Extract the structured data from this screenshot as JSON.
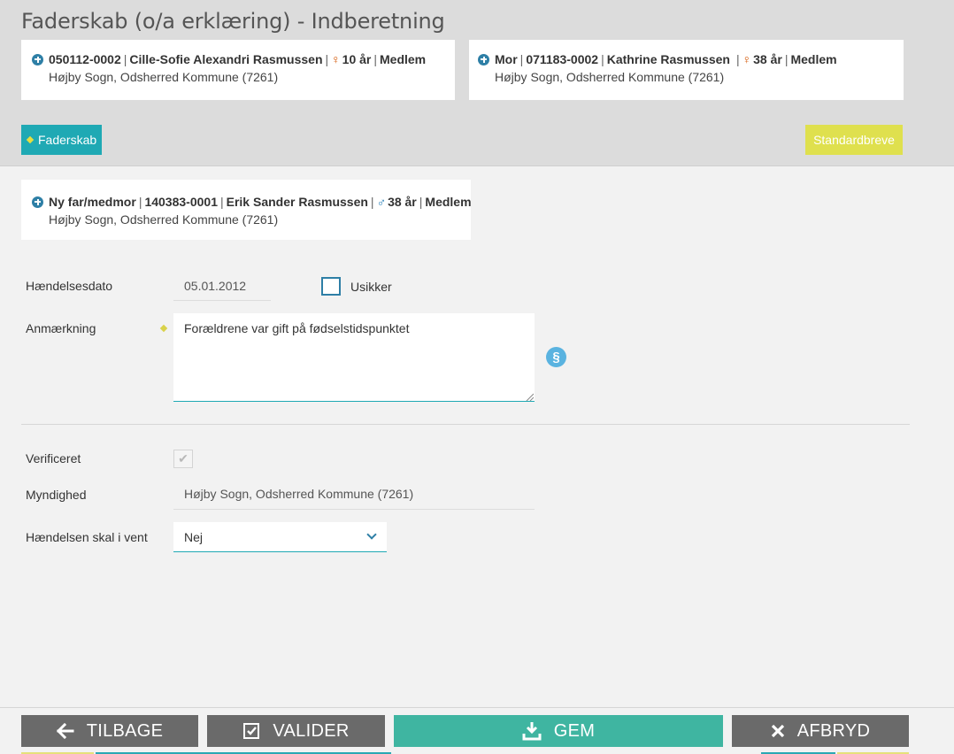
{
  "page": {
    "title": "Faderskab (o/a erklæring) - Indberetning"
  },
  "persons": {
    "child": {
      "cpr": "050112-0002",
      "name": "Cille-Sofie Alexandri Rasmussen",
      "age": "10 år",
      "status": "Medlem",
      "address": "Højby Sogn, Odsherred Kommune (7261)"
    },
    "mother": {
      "role": "Mor",
      "cpr": "071183-0002",
      "name": "Kathrine Rasmussen",
      "age": "38 år",
      "status": "Medlem",
      "address": "Højby Sogn, Odsherred Kommune (7261)"
    },
    "father": {
      "role": "Ny far/medmor",
      "cpr": "140383-0001",
      "name": "Erik Sander Rasmussen",
      "age": "38 år",
      "status": "Medlem",
      "address": "Højby Sogn, Odsherred Kommune (7261)"
    }
  },
  "toolbar": {
    "faderskab_label": "Faderskab",
    "standardbreve_label": "Standardbreve"
  },
  "form": {
    "event_date_label": "Hændelsesdato",
    "event_date_value": "05.01.2012",
    "uncertain_label": "Usikker",
    "remark_label": "Anmærkning",
    "remark_value": "Forældrene var gift på fødselstidspunktet",
    "paragraph_symbol": "§",
    "verified_label": "Verificeret",
    "verified_checked": true,
    "authority_label": "Myndighed",
    "authority_value": "Højby Sogn, Odsherred Kommune (7261)",
    "on_hold_label": "Hændelsen skal i vent",
    "on_hold_value": "Nej"
  },
  "footer": {
    "back_label": "TILBAGE",
    "validate_label": "VALIDER",
    "save_label": "GEM",
    "cancel_label": "AFBRYD"
  },
  "colors": {
    "header_bg": "#dcdcdc",
    "accent_teal": "#1fa9b4",
    "accent_yellow": "#dfe04e",
    "save_green": "#3fb5a1",
    "button_grey": "#6a6a6a",
    "icon_blue": "#2e7fa6"
  }
}
